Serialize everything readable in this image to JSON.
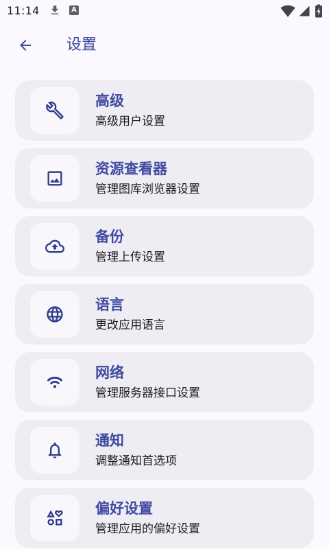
{
  "status_bar": {
    "time": "11:14",
    "notification_letter": "A",
    "icons": {
      "download": "download-icon",
      "notification": "text-app-notification-icon",
      "wifi": "wifi-signal-icon",
      "cellular": "cellular-signal-icon",
      "battery": "battery-charging-icon"
    }
  },
  "app_bar": {
    "title": "设置",
    "back_icon": "arrow-back-icon"
  },
  "settings_items": [
    {
      "title": "高级",
      "subtitle": "高级用户设置",
      "icon": "wrench-icon"
    },
    {
      "title": "资源查看器",
      "subtitle": "管理图库浏览器设置",
      "icon": "image-icon"
    },
    {
      "title": "备份",
      "subtitle": "管理上传设置",
      "icon": "cloud-upload-icon"
    },
    {
      "title": "语言",
      "subtitle": "更改应用语言",
      "icon": "globe-icon"
    },
    {
      "title": "网络",
      "subtitle": "管理服务器接口设置",
      "icon": "wifi-icon"
    },
    {
      "title": "通知",
      "subtitle": "调整通知首选项",
      "icon": "bell-icon"
    },
    {
      "title": "偏好设置",
      "subtitle": "管理应用的偏好设置",
      "icon": "shapes-icon"
    }
  ],
  "colors": {
    "background": "#fbf8ff",
    "card": "#efedf4",
    "icon_tile": "#f9f7fc",
    "accent": "#3f4aa0",
    "icon": "#2e3a8c",
    "text_primary": "#1b1b1f"
  }
}
